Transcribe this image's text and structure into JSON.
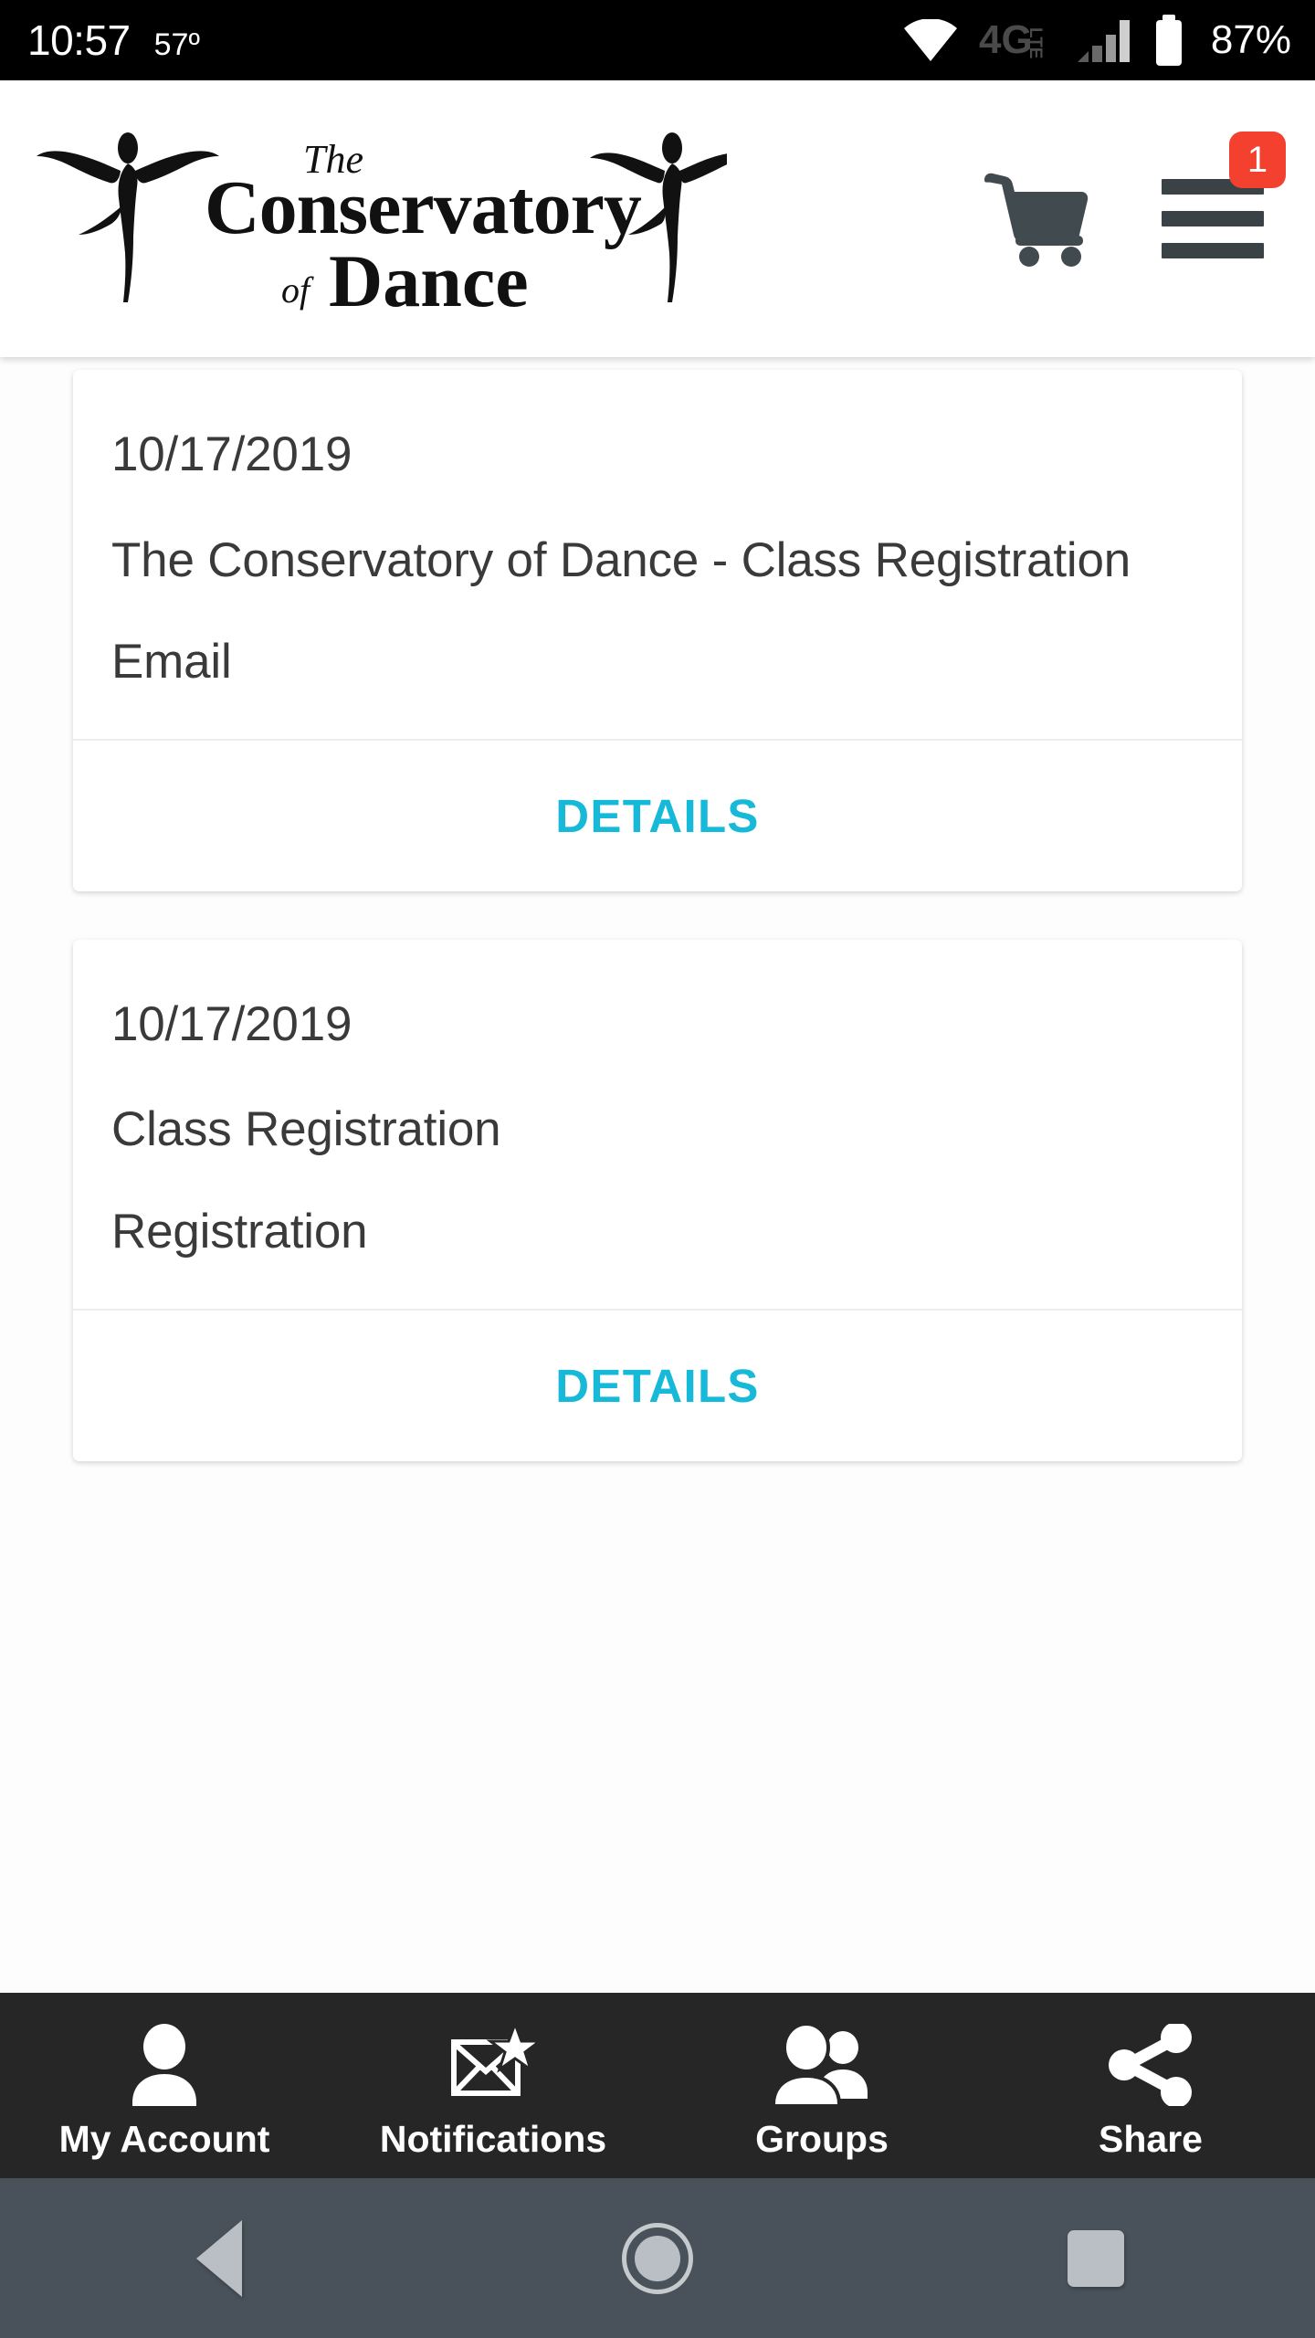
{
  "status_bar": {
    "time": "10:57",
    "temperature": "57º",
    "battery_percent": "87%",
    "network_type": "4G",
    "network_suffix": "LTE",
    "icons": [
      "wifi-icon",
      "network-4glte-icon",
      "cellular-signal-icon",
      "battery-icon"
    ]
  },
  "header": {
    "logo_text_line1": "The",
    "logo_text_line2": "Conservatory",
    "logo_text_line3": "of Dance",
    "logo_alt": "The Conservatory of Dance",
    "cart_icon": "shopping-cart-icon",
    "menu_icon": "hamburger-menu-icon",
    "menu_badge_count": "1",
    "badge_color": "#f4402e"
  },
  "content": {
    "accent_color": "#17b9d8",
    "cards": [
      {
        "date": "10/17/2019",
        "title": "The Conservatory of Dance - Class Registration",
        "type": "Email",
        "action_label": "DETAILS"
      },
      {
        "date": "10/17/2019",
        "title": "Class Registration",
        "type": "Registration",
        "action_label": "DETAILS"
      }
    ]
  },
  "tab_bar": {
    "background_color": "#262626",
    "items": [
      {
        "label": "My Account",
        "icon": "person-icon"
      },
      {
        "label": "Notifications",
        "icon": "envelope-star-icon"
      },
      {
        "label": "Groups",
        "icon": "people-group-icon"
      },
      {
        "label": "Share",
        "icon": "share-nodes-icon"
      }
    ]
  },
  "system_nav": {
    "background_color": "#49515a",
    "buttons": [
      {
        "name": "back",
        "icon": "triangle-back-icon"
      },
      {
        "name": "home",
        "icon": "circle-home-icon"
      },
      {
        "name": "recents",
        "icon": "square-recents-icon"
      }
    ]
  }
}
